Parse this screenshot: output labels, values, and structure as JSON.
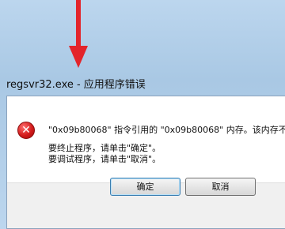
{
  "window": {
    "title": "regsvr32.exe - 应用程序错误"
  },
  "dialog": {
    "icon": "error-icon",
    "icon_glyph": "✕",
    "message_line1": "\"0x09b80068\" 指令引用的 \"0x09b80068\" 内存。该内存不",
    "message_line2": "要终止程序，请单击\"确定\"。",
    "message_line3": "要调试程序，请单击\"取消\"。"
  },
  "buttons": {
    "ok_label": "确定",
    "cancel_label": "取消"
  },
  "colors": {
    "arrow": "#e3242b",
    "frame": "#b9d3ea"
  }
}
